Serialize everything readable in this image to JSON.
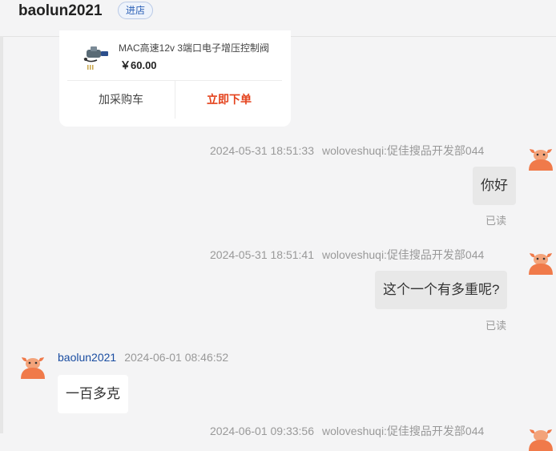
{
  "header": {
    "shop_name": "baolun2021",
    "enter_store_label": "进店"
  },
  "product_card": {
    "title": "MAC高速12v 3端口电子增压控制阀",
    "price": "￥60.00",
    "add_to_cart_label": "加采购车",
    "buy_now_label": "立即下单"
  },
  "messages": [
    {
      "side": "right",
      "timestamp": "2024-05-31 18:51:33",
      "sender": "woloveshuqi:促佳搜品开发部044",
      "text": "你好",
      "status": "已读"
    },
    {
      "side": "right",
      "timestamp": "2024-05-31 18:51:41",
      "sender": "woloveshuqi:促佳搜品开发部044",
      "text": "这个一个有多重呢?",
      "status": "已读"
    },
    {
      "side": "left",
      "timestamp": "2024-06-01 08:46:52",
      "sender": "baolun2021",
      "text": "一百多克"
    },
    {
      "side": "right",
      "timestamp": "2024-06-01 09:33:56",
      "sender": "woloveshuqi:促佳搜品开发部044"
    }
  ],
  "colors": {
    "background": "#f4f4f5",
    "buy_accent": "#e4421c",
    "sender_link": "#1a4da1",
    "avatar": "#f07a4a"
  }
}
